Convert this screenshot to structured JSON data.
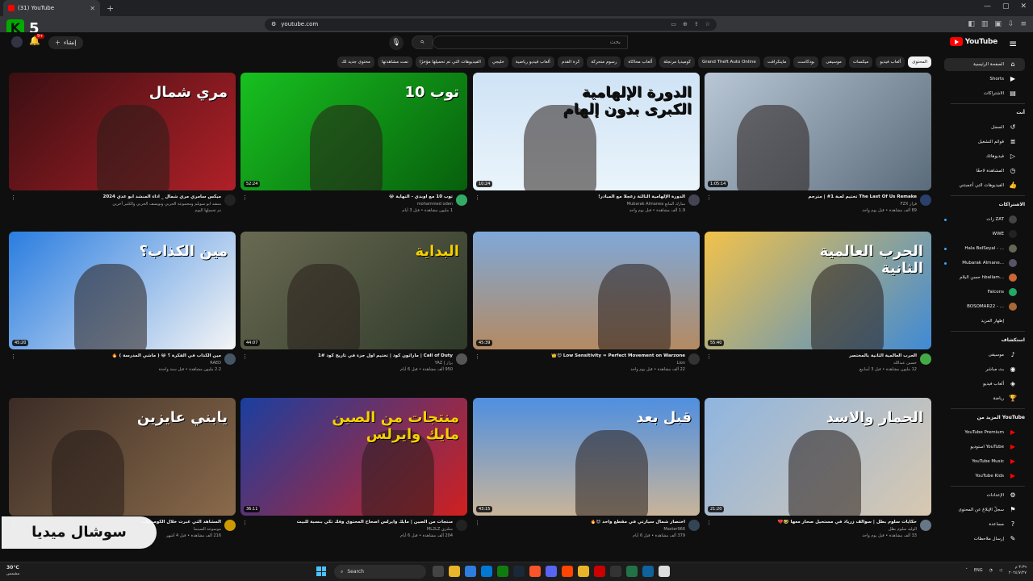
{
  "browser": {
    "tab_title": "(31) YouTube",
    "url": "youtube.com"
  },
  "overlay": {
    "k5_text": "5",
    "watermark": "سوشال ميديا"
  },
  "header": {
    "logo": "YouTube",
    "search_placeholder": "بحث",
    "create_label": "إنشاء",
    "notifications_count": "9+"
  },
  "chips": [
    {
      "label": "المحتوى",
      "active": true
    },
    {
      "label": "ألعاب فيديو"
    },
    {
      "label": "ميكسات"
    },
    {
      "label": "موسيقى"
    },
    {
      "label": "بودكاست"
    },
    {
      "label": "ماينكرافت"
    },
    {
      "label": "Grand Theft Auto Online"
    },
    {
      "label": "كوميديا مرتجلة"
    },
    {
      "label": "ألعاب محاكاة"
    },
    {
      "label": "رسوم متحركة"
    },
    {
      "label": "كرة القدم"
    },
    {
      "label": "ألعاب فيديو رياضية"
    },
    {
      "label": "خليجي"
    },
    {
      "label": "الفيديوهات التي تم تحميلها مؤخرًا"
    },
    {
      "label": "تمت مشاهدتها"
    },
    {
      "label": "محتوى جديد لك"
    }
  ],
  "sidebar": {
    "main": [
      {
        "label": "الصفحة الرئيسية",
        "icon": "home-icon",
        "active": true
      },
      {
        "label": "Shorts",
        "icon": "shorts-icon"
      },
      {
        "label": "الاشتراكات",
        "icon": "subscriptions-icon"
      }
    ],
    "you_head": "أنت",
    "you": [
      {
        "label": "السجل",
        "icon": "history-icon"
      },
      {
        "label": "قوائم التشغيل",
        "icon": "playlist-icon"
      },
      {
        "label": "فيديوهاتك",
        "icon": "your-videos-icon"
      },
      {
        "label": "المشاهدة لاحقًا",
        "icon": "watch-later-icon"
      },
      {
        "label": "الفيديوهات التي أعجبتني",
        "icon": "like-icon"
      }
    ],
    "subs_head": "الاشتراكات",
    "subs": [
      {
        "label": "زات ZAT",
        "color": "#444"
      },
      {
        "label": "WWE",
        "color": "#222"
      },
      {
        "label": "Hala BelSeyal - ...",
        "color": "#665"
      },
      {
        "label": "Mubarak Almane...",
        "color": "#556"
      },
      {
        "label": "حسن البلام hballam...",
        "color": "#c63"
      },
      {
        "label": "Falcons",
        "color": "#2a6"
      },
      {
        "label": "BOSOMAR22 - ...",
        "color": "#a63"
      },
      {
        "label": "إظهار المزيد",
        "color": "#0f0f0f"
      }
    ],
    "explore_head": "استكشاف",
    "explore": [
      {
        "label": "موسيقى",
        "icon": "music-icon"
      },
      {
        "label": "بث مباشر",
        "icon": "live-icon"
      },
      {
        "label": "ألعاب فيديو",
        "icon": "gaming-icon"
      },
      {
        "label": "رياضة",
        "icon": "trophy-icon"
      }
    ],
    "more_head": "المزيد من YouTube",
    "more": [
      {
        "label": "YouTube Premium"
      },
      {
        "label": "استوديو YouTube"
      },
      {
        "label": "YouTube Music"
      },
      {
        "label": "YouTube Kids"
      }
    ],
    "settings": [
      {
        "label": "الإعدادات",
        "icon": "gear-icon"
      },
      {
        "label": "سجلّ الإبلاغ عن المحتوى",
        "icon": "flag-icon"
      },
      {
        "label": "مساعدة",
        "icon": "help-icon"
      },
      {
        "label": "إرسال ملاحظات",
        "icon": "feedback-icon"
      }
    ]
  },
  "videos": [
    {
      "title": "The Last Of Us Remake تختيم لعبة 1# | مترجم",
      "channel": "فزاز FZX",
      "stats": "89 ألف مشاهدة • قبل يوم واحد",
      "duration": "1:05:14",
      "caption": ""
    },
    {
      "title": "الدورة الإلهامية الثالثة زعجلاً مع المبادر!",
      "channel": "مبارك المانع Mubarak Almanea",
      "stats": "1.9 ألف مشاهدة • قبل يوم واحد",
      "duration": "10:24",
      "caption": "الدورة الإلهامية الكبرى بدون إلهام"
    },
    {
      "title": "توب 10 مع اوبدي - النهاية 😂",
      "channel": "mohammed oden",
      "stats": "1 مليون مشاهدة • قبل 3 أيام",
      "duration": "52:24",
      "caption": "توب 10"
    },
    {
      "title": "ميكس سامري مري شمال _ اداء المنشد ابو عدي 2024",
      "channel": "منشد ابو سويلم ومجموعة الحربي ونويسف الحربي والكثير آخرين",
      "stats": "تم تحميلها اليوم",
      "duration": "",
      "caption": "مري شمال"
    },
    {
      "title": "الحرب العالمية الثانية بالمختصر",
      "channel": "حسين عبدالله",
      "stats": "12 مليون مشاهدة • قبل 3 أسابيع",
      "duration": "55:40",
      "caption": "الحرب العالمية الثانية"
    },
    {
      "title": "Low Sensitivity = Perfect Movement on Warzone 😈👑",
      "channel": "Lion",
      "stats": "22 ألف مشاهدة • قبل يوم واحد",
      "duration": "45:39",
      "caption": ""
    },
    {
      "title": "Call of Duty | ماراثون كود | تختيم أول جزء في تاريخ كود #1",
      "channel": "يزاز | YAZ",
      "stats": "950 ألف مشاهدة • قبل 6 أيام",
      "duration": "44:07",
      "caption": "البداية"
    },
    {
      "title": "مين الكذاب في الفكرة ؟ 😂 ( ماشي المدرسة ) 🔥",
      "channel": "RAED",
      "stats": "2.2 مليون مشاهدة • قبل سنة واحدة",
      "duration": "45:20",
      "caption": "مين الكذاب؟"
    },
    {
      "title": "حكايات سلوم بطل | سوالف زرياد في مستحيل صحار معها 🤣💔",
      "channel": "الوليد سلوم بطل",
      "stats": "33 ألف مشاهدة • قبل يوم واحد",
      "duration": "21:20",
      "caption": "الحمار والاسد"
    },
    {
      "title": "اختصار شمال سيارتي في مقطع واحد 😍🔥",
      "channel": "Master966",
      "stats": "379 ألف مشاهدة • قبل 6 أيام",
      "duration": "43:15",
      "caption": "قبل  بعد"
    },
    {
      "title": "منتجات من الصين | مايك وايرلس اصحاح المحتوى وفك تكي بنسبة للبيت",
      "channel": "سلتزي ML2LZ",
      "stats": "204 ألف مشاهدة • قبل 6 أيام",
      "duration": "36:11",
      "caption": "منتجات من الصين مايك وايرلس"
    },
    {
      "title": "المشاهد التي عبرت خلال الكوميديا...",
      "channel": "موسوعة السينما",
      "stats": "216 ألف مشاهدة • قبل 4 أشهر",
      "duration": "",
      "caption": "يابني عايزين"
    }
  ],
  "taskbar": {
    "temp": "30°C",
    "weather_desc": "مشمس",
    "search_label": "Search",
    "lang": "ENG",
    "time": "٣:٣٩ م",
    "date": "٢٠٢٤/٧/٢٧"
  }
}
